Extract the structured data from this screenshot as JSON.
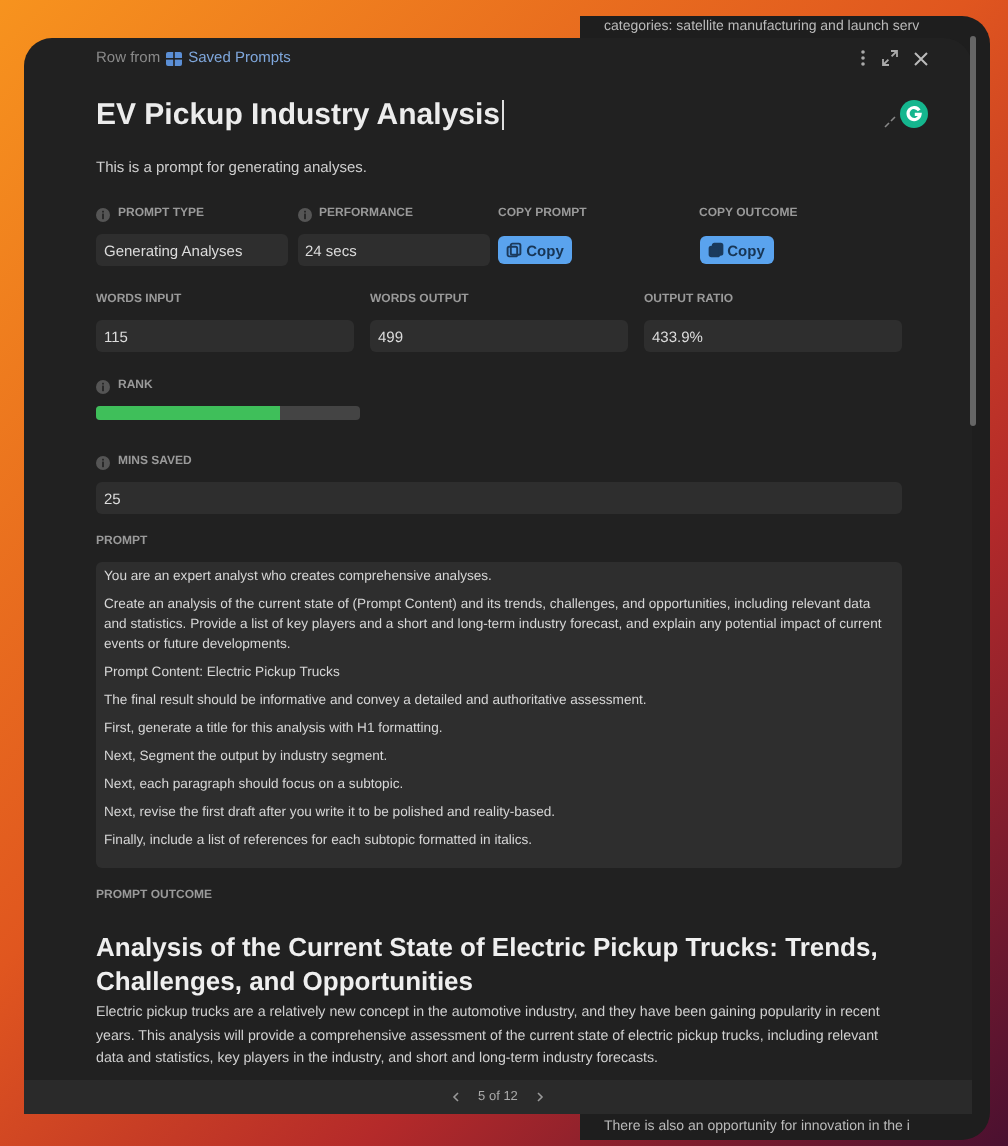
{
  "background_text": {
    "top": "categories: satellite manufacturing and launch serv",
    "bottom": "There is also an opportunity for innovation in the i"
  },
  "breadcrumb": {
    "prefix": "Row from",
    "link": "Saved Prompts"
  },
  "title": "EV Pickup Industry Analysis",
  "description": "This is a prompt for generating analyses.",
  "fields_row1": [
    {
      "kind": "text",
      "label": "PROMPT TYPE",
      "value": "Generating Analyses"
    },
    {
      "kind": "text",
      "label": "PERFORMANCE",
      "value": "24 secs"
    },
    {
      "kind": "copy",
      "label": "COPY PROMPT",
      "button": "Copy"
    },
    {
      "kind": "copy",
      "label": "COPY OUTCOME",
      "button": "Copy"
    }
  ],
  "fields_row2": [
    {
      "label": "WORDS INPUT",
      "value": "115"
    },
    {
      "label": "WORDS OUTPUT",
      "value": "499"
    },
    {
      "label": "OUTPUT RATIO",
      "value": "433.9%"
    }
  ],
  "rank": {
    "label": "RANK",
    "level": 0.7
  },
  "mins_saved": {
    "label": "MINS SAVED",
    "value": "25"
  },
  "prompt": {
    "label": "PROMPT",
    "paragraphs": [
      "You are an expert analyst who creates comprehensive analyses.",
      "Create an analysis of the current state of (Prompt Content) and its trends, challenges, and opportunities, including relevant data and statistics. Provide a list of key players and a short and long-term industry forecast, and explain any potential impact of current events or future developments.",
      "Prompt Content: Electric Pickup Trucks",
      "The final result should be informative and convey a detailed and authoritative assessment.",
      "First, generate a title for this analysis with H1 formatting.",
      "Next, Segment the output by industry segment.",
      "Next, each paragraph should focus on a subtopic.",
      "Next, revise the first draft after you write it to be polished and reality-based.",
      "Finally, include a list of references for each subtopic formatted in italics."
    ]
  },
  "outcome": {
    "label": "PROMPT OUTCOME",
    "heading": "Analysis of the Current State of Electric Pickup Trucks: Trends, Challenges, and Opportunities",
    "body": "Electric pickup trucks are a relatively new concept in the automotive industry, and they have been gaining popularity in recent years. This analysis will provide a comprehensive assessment of the current state of electric pickup trucks, including relevant data and statistics, key players in the industry, and short and long-term industry forecasts."
  },
  "pager": {
    "text": "5 of 12"
  }
}
